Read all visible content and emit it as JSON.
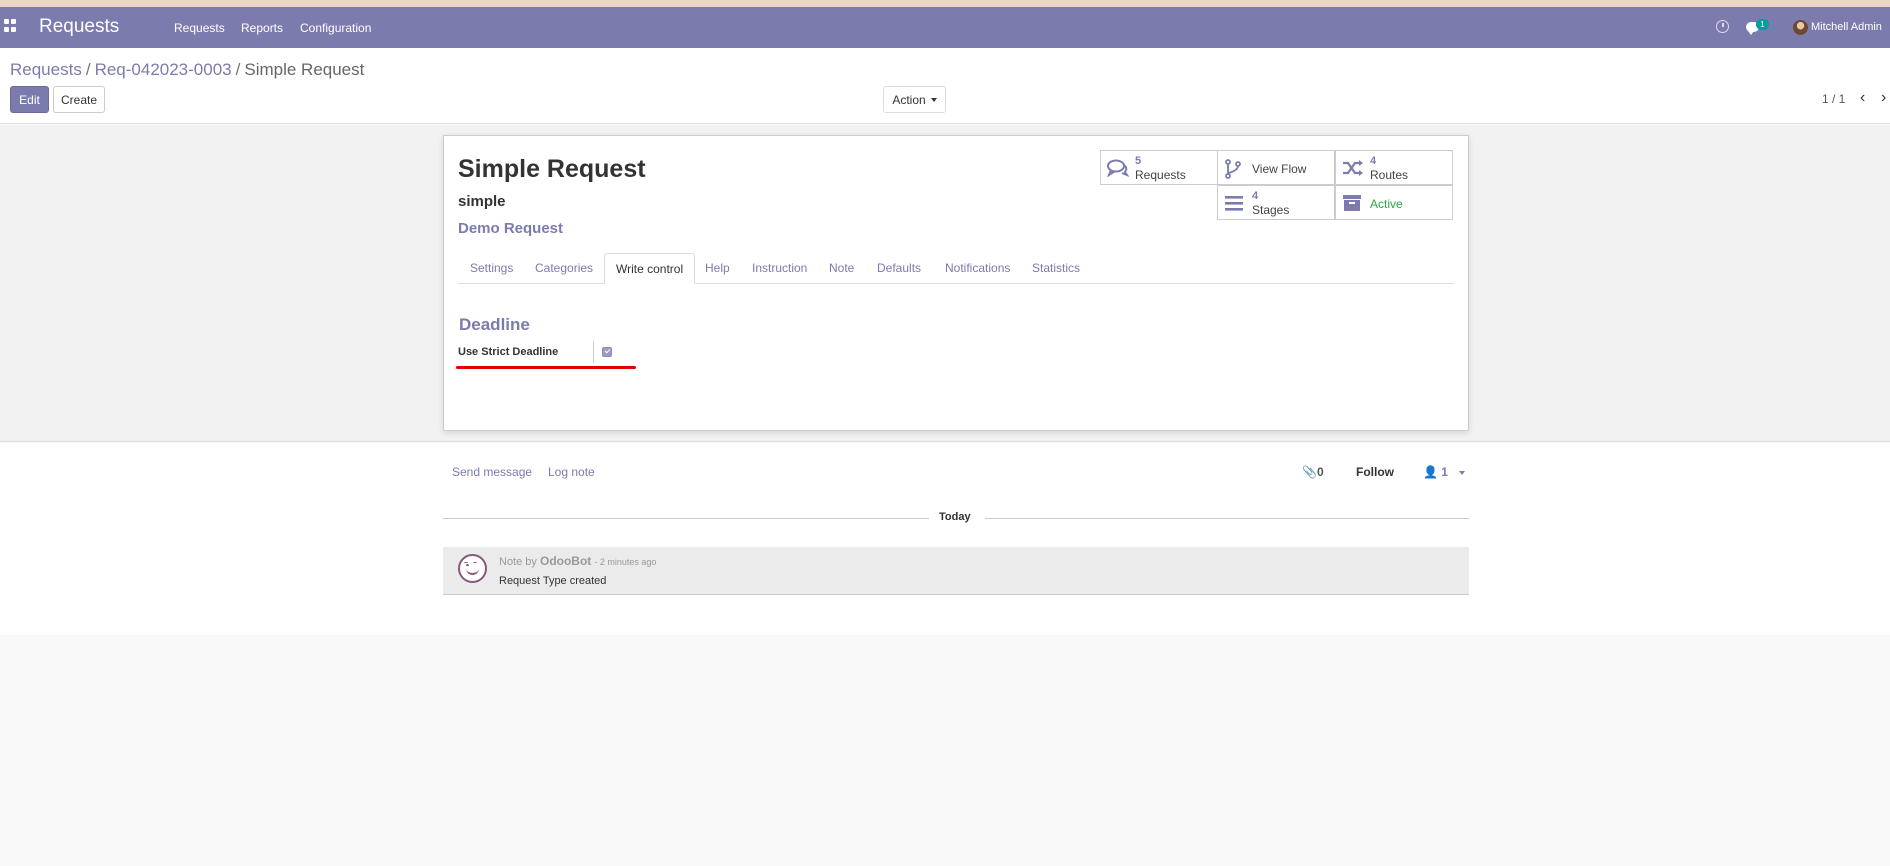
{
  "navbar": {
    "app_title": "Requests",
    "menu": [
      "Requests",
      "Reports",
      "Configuration"
    ],
    "chat_count": "1",
    "user_name": "Mitchell Admin"
  },
  "breadcrumb": {
    "root": "Requests",
    "middle": "Req-042023-0003",
    "current": "Simple Request"
  },
  "buttons": {
    "edit": "Edit",
    "create": "Create",
    "action": "Action"
  },
  "pager": {
    "text": "1 / 1"
  },
  "form": {
    "title": "Simple Request",
    "code": "simple",
    "subtitle": "Demo Request",
    "smart_buttons": {
      "requests": {
        "count": "5",
        "label": "Requests"
      },
      "view_flow": {
        "label": "View Flow"
      },
      "routes": {
        "count": "4",
        "label": "Routes"
      },
      "stages": {
        "count": "4",
        "label": "Stages"
      },
      "active": {
        "label": "Active"
      }
    },
    "tabs": [
      "Settings",
      "Categories",
      "Write control",
      "Help",
      "Instruction",
      "Note",
      "Defaults",
      "Notifications",
      "Statistics"
    ],
    "active_tab": "Write control",
    "section_title": "Deadline",
    "field_label": "Use Strict Deadline",
    "field_checked": true
  },
  "chatter": {
    "send_message": "Send message",
    "log_note": "Log note",
    "attachments": "0",
    "follow": "Follow",
    "followers": "1",
    "date_separator": "Today",
    "message": {
      "prefix": "Note by",
      "author": "OdooBot",
      "time": "- 2 minutes ago",
      "body": "Request Type created"
    }
  },
  "colors": {
    "brand": "#7c7bad",
    "active": "#28a745",
    "highlight": "#e00000"
  }
}
